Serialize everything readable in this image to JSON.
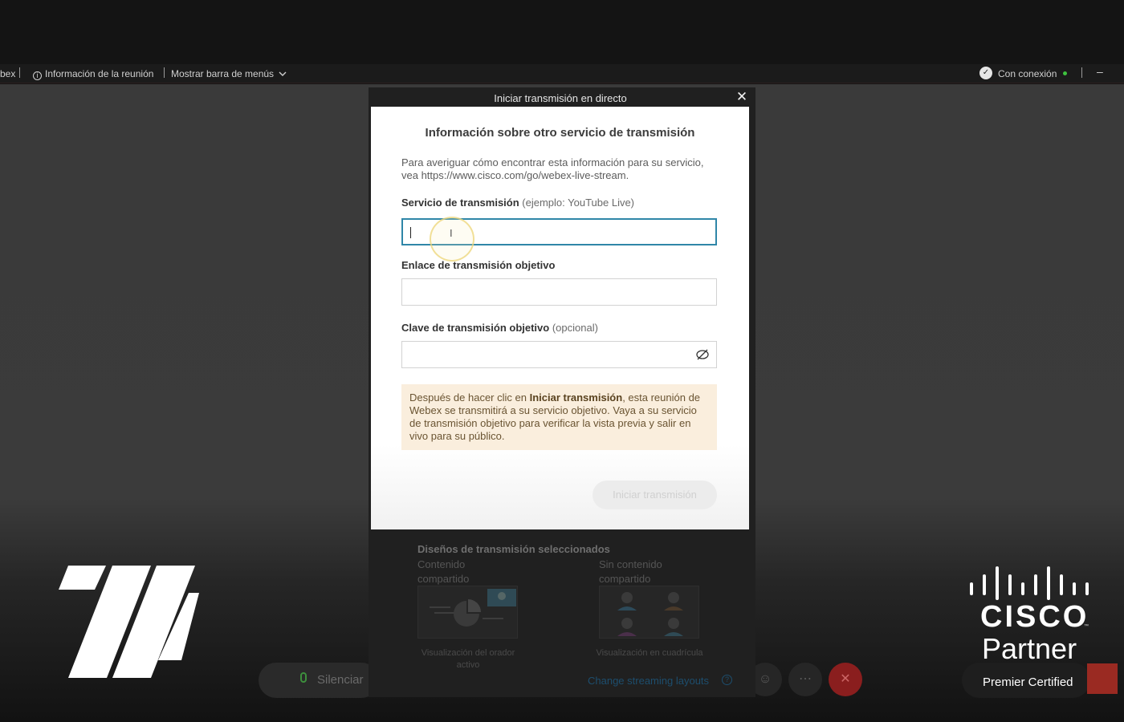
{
  "menubar": {
    "app_fragment": "bex",
    "meeting_info": "Información de la reunión",
    "show_menu_bar": "Mostrar barra de menús",
    "connection": "Con conexión"
  },
  "dialog": {
    "title": "Iniciar transmisión en directo",
    "close": "✕",
    "heading": "Información sobre otro servicio de transmisión",
    "description": "Para averiguar cómo encontrar esta información para su servicio, vea https://www.cisco.com/go/webex-live-stream.",
    "service_label": "Servicio de transmisión",
    "service_hint": "(ejemplo: YouTube Live)",
    "service_value": "",
    "link_label": "Enlace de transmisión objetivo",
    "link_value": "",
    "key_label": "Clave de transmisión objetivo",
    "key_hint": "(opcional)",
    "key_value": "",
    "notice_before": "Después de hacer clic en ",
    "notice_bold": "Iniciar transmisión",
    "notice_after": ", esta reunión de Webex se transmitirá a su servicio objetivo. Vaya a su servicio de transmisión objetivo para verificar la vista previa y salir en vivo para su público.",
    "start_button": "Iniciar transmisión",
    "layouts_title": "Diseños de transmisión seleccionados",
    "layout_shared": "Contenido compartido",
    "layout_no_content": "Sin contenido compartido",
    "layout_shared_caption": "Visualización del orador activo",
    "layout_grid_caption": "Visualización en cuadrícula",
    "change_layouts": "Change streaming layouts"
  },
  "controls": {
    "mute_label": "Silenciar"
  },
  "branding": {
    "cisco": "CISCO",
    "tm": "™",
    "partner": "Partner",
    "premier": "Premier Certified"
  },
  "colors": {
    "accent": "#2f86a8",
    "notice_bg": "#faeedd",
    "status_online": "#3ec23e",
    "end_call": "#8a1e1e"
  }
}
